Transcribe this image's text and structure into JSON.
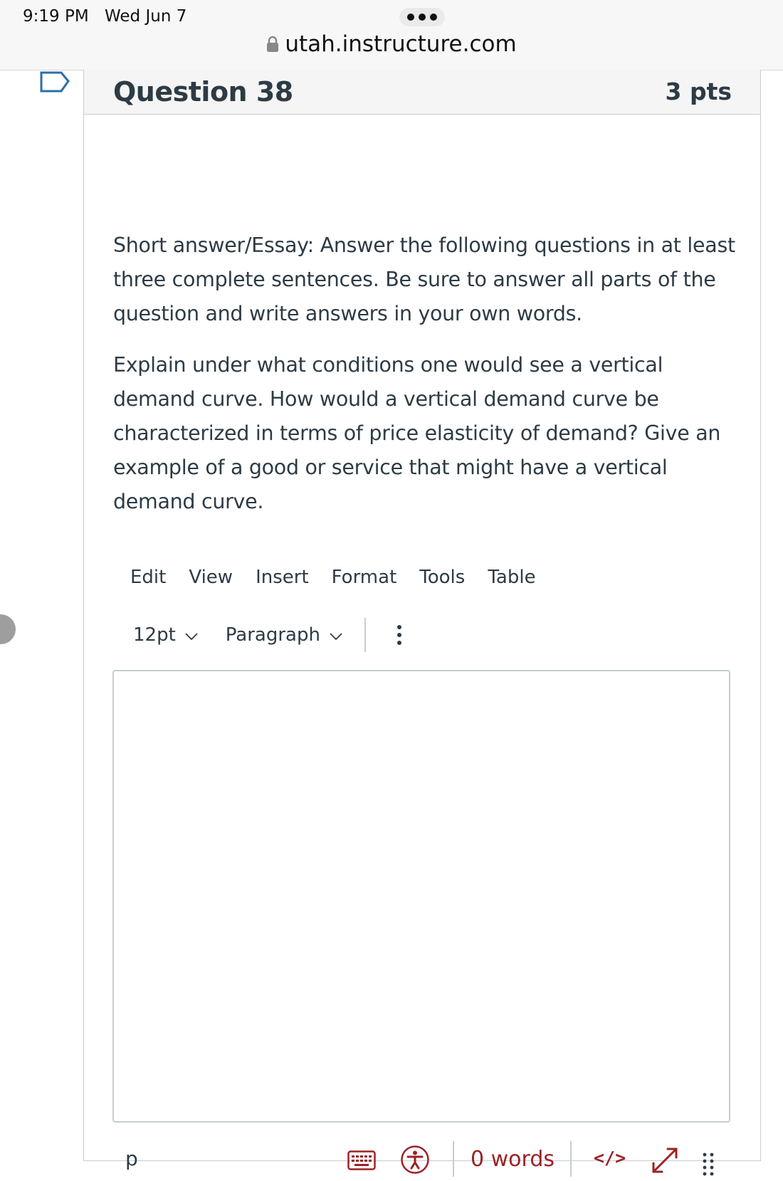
{
  "status_bar": {
    "time": "9:19 PM",
    "date": "Wed Jun 7"
  },
  "browser": {
    "url": "utah.instructure.com"
  },
  "question": {
    "title": "Question 38",
    "points": "3 pts",
    "instructions": "Short answer/Essay: Answer the following questions in at least three complete sentences. Be sure to answer all parts of the question and write answers in your own words.",
    "prompt": "Explain under what conditions one would see a vertical demand curve. How would a vertical demand curve be characterized in terms of price elasticity of demand? Give an example of a good or service that might have a vertical demand curve."
  },
  "editor": {
    "menu": [
      "Edit",
      "View",
      "Insert",
      "Format",
      "Tools",
      "Table"
    ],
    "font_size": "12pt",
    "block_format": "Paragraph",
    "content": "",
    "path": "p",
    "word_count": "0 words",
    "html_toggle": "</>"
  },
  "colors": {
    "text": "#2d3b45",
    "accent_red": "#9b2225",
    "border": "#c7cdd1"
  }
}
